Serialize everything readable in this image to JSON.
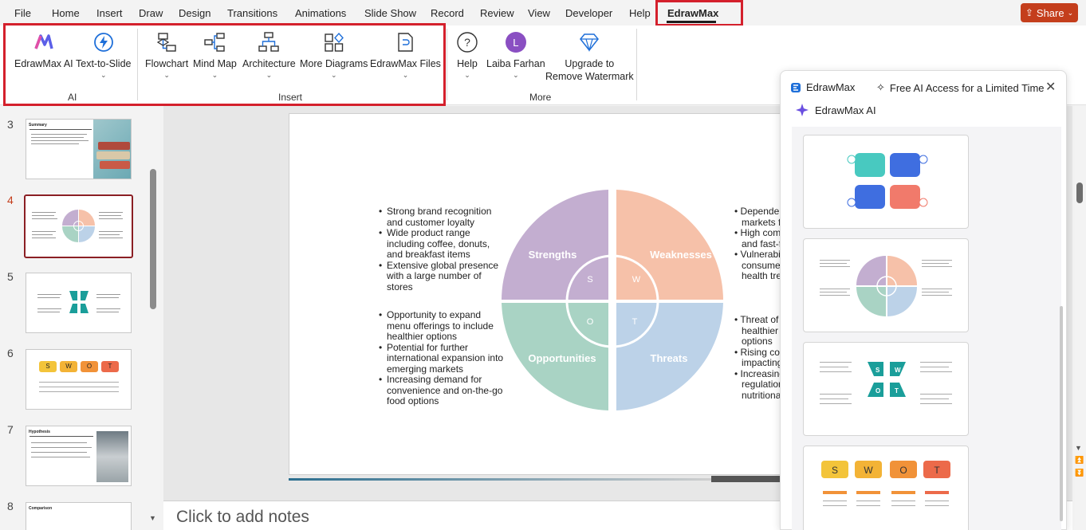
{
  "menu": {
    "tabs": [
      "File",
      "Home",
      "Insert",
      "Draw",
      "Design",
      "Transitions",
      "Animations",
      "Slide Show",
      "Record",
      "Review",
      "View",
      "Developer",
      "Help",
      "EdrawMax"
    ],
    "share_label": "Share"
  },
  "ribbon": {
    "ai_group": {
      "label": "AI",
      "edrawmax_ai": "EdrawMax AI",
      "text_to_slide": "Text-to-Slide"
    },
    "insert_group": {
      "label": "Insert",
      "flowchart": "Flowchart",
      "mind_map": "Mind Map",
      "architecture": "Architecture",
      "more_diagrams": "More Diagrams",
      "edrawmax_files": "EdrawMax Files"
    },
    "more_group": {
      "label": "More",
      "help": "Help",
      "user_name": "Laiba Farhan",
      "user_initial": "L",
      "upgrade_line1": "Upgrade to",
      "upgrade_line2": "Remove Watermark"
    }
  },
  "thumbnails": {
    "numbers": [
      "3",
      "4",
      "5",
      "6",
      "7",
      "8"
    ],
    "selected": "4",
    "thumb3_title": "Summary",
    "thumb7_title": "Hypothesis",
    "thumb8_title": "Comparison",
    "thumb6_letters": [
      "S",
      "W",
      "O",
      "T"
    ]
  },
  "slide": {
    "labels": {
      "strengths": "Strengths",
      "weaknesses": "Weaknesses",
      "opportunities": "Opportunities",
      "threats": "Threats",
      "s": "S",
      "w": "W",
      "o": "O",
      "t": "T"
    },
    "colors": {
      "strengths": "#c3aed0",
      "weaknesses": "#f6c1a9",
      "opportunities": "#a9d3c4",
      "threats": "#bcd2e8"
    },
    "strengths_bullets": [
      "Strong brand recognition and customer loyalty",
      "Wide product range including coffee, donuts, and breakfast items",
      "Extensive global presence with a large number of stores"
    ],
    "opportunities_bullets": [
      "Opportunity to expand menu offerings to include healthier options",
      "Potential for further international expansion into emerging markets",
      "Increasing demand for convenience and on-the-go food options"
    ],
    "weaknesses_bullets": [
      "Dependen",
      "markets fo",
      "High comp",
      "and fast-fi",
      "Vulnerabil",
      "consumer",
      "health tre"
    ],
    "threats_bullets": [
      "Threat of",
      "healthier f",
      "options",
      "Rising cos",
      "impacting",
      "Increasing",
      "regulation",
      "nutritional"
    ]
  },
  "notes": {
    "placeholder": "Click to add notes"
  },
  "panel": {
    "tab_edrawmax": "EdrawMax",
    "tab_free_ai": "Free AI Access for a Limited Time",
    "ai_label": "EdrawMax AI",
    "card3_letters": [
      "S",
      "W",
      "O",
      "T"
    ],
    "card4_letters": [
      "S",
      "W",
      "O",
      "T"
    ]
  }
}
